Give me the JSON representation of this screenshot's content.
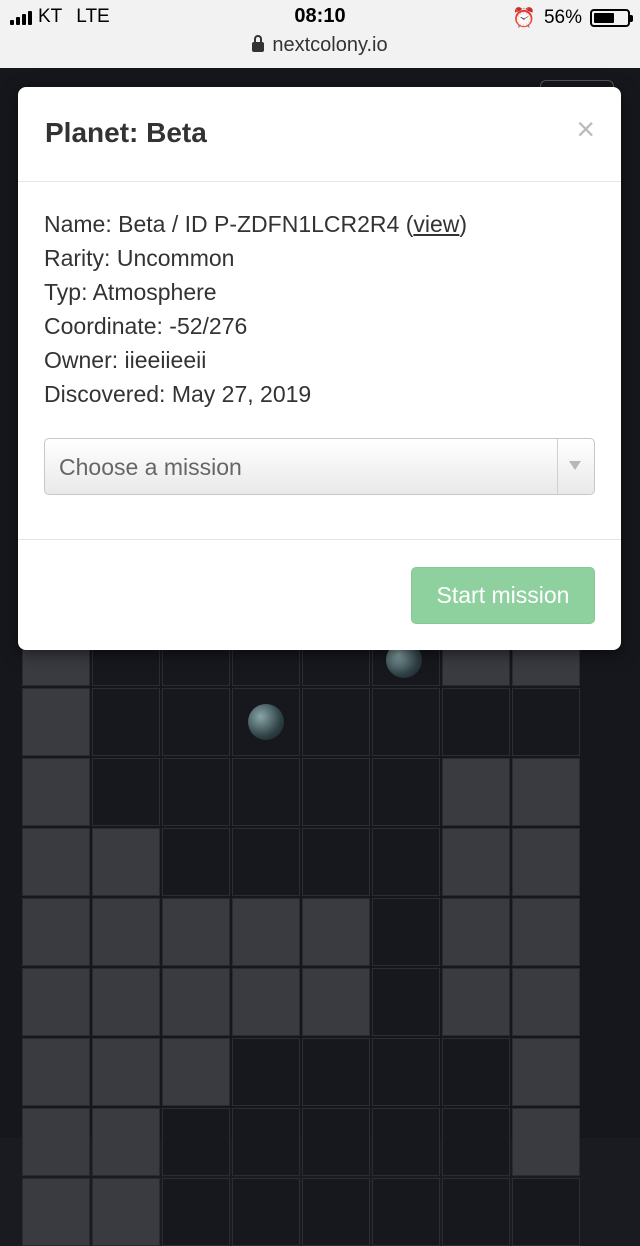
{
  "status_bar": {
    "carrier": "KT",
    "network": "LTE",
    "time": "08:10",
    "battery_percent": "56%",
    "battery_level": 0.56,
    "url": "nextcolony.io"
  },
  "modal": {
    "title": "Planet: Beta",
    "close_glyph": "×",
    "info": {
      "name_prefix": "Name: Beta / ID P-ZDFN1LCR2R4 (",
      "view_link": "view",
      "name_suffix": ")",
      "rarity": "Rarity: Uncommon",
      "typ": "Typ: Atmosphere",
      "coordinate": "Coordinate: -52/276",
      "owner": "Owner: iieeiieeii",
      "discovered": "Discovered: May 27, 2019"
    },
    "mission_select": {
      "placeholder": "Choose a mission"
    },
    "start_button": "Start mission"
  },
  "colors": {
    "start_button": "#8fd19e",
    "background": "#15171c"
  }
}
